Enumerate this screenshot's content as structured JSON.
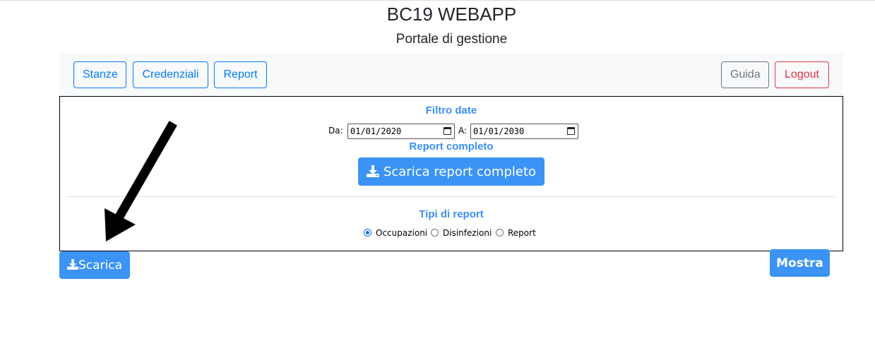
{
  "header": {
    "title": "BC19 WEBAPP",
    "subtitle": "Portale di gestione"
  },
  "nav": {
    "stanze": "Stanze",
    "credenziali": "Credenziali",
    "report": "Report",
    "guida": "Guida",
    "logout": "Logout"
  },
  "filter": {
    "title": "Filtro date",
    "from_label": "Da:",
    "from_value": "01/01/2020",
    "to_label": "A:",
    "to_value": "01/01/2030"
  },
  "full_report": {
    "title": "Report completo",
    "button": "Scarica report completo"
  },
  "report_types": {
    "title": "Tipi di report",
    "options": [
      {
        "label": "Occupazioni",
        "checked": true
      },
      {
        "label": "Disinfezioni",
        "checked": false
      },
      {
        "label": "Report",
        "checked": false
      }
    ]
  },
  "actions": {
    "scarica": "Scarica",
    "mostra": "Mostra"
  },
  "colors": {
    "primary": "#3b93f5",
    "outline_primary": "#007bff",
    "guida": "#6c757d",
    "logout": "#dc3545",
    "section_label": "#3a8ff4"
  }
}
